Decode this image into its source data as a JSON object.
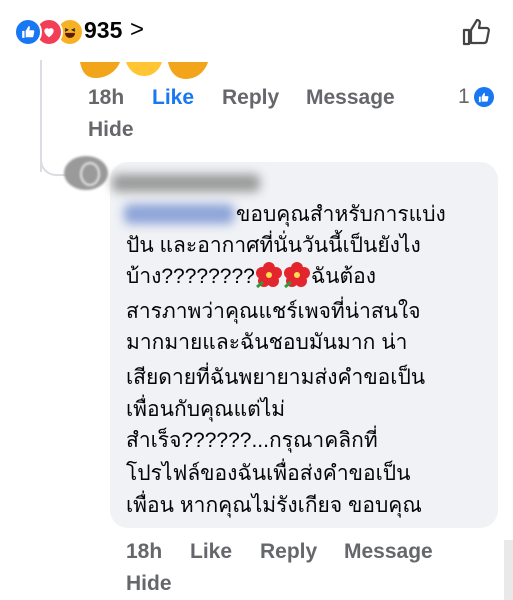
{
  "header": {
    "reaction_count": "935",
    "count_arrow": ">",
    "reaction_icons": [
      "like-icon",
      "love-icon",
      "haha-icon"
    ],
    "like_page_icon": "thumb-up-icon"
  },
  "prev_comment": {
    "time": "18h",
    "like": "Like",
    "reply": "Reply",
    "message": "Message",
    "hide": "Hide",
    "reaction_count": "1",
    "like_color": "#1877f2"
  },
  "comment": {
    "lines": [
      "ขอบคุณสำหรับการแบ่ง",
      "ปัน และอากาศที่นั่นวันนี้เป็นยังไง",
      "บ้าง????????",
      "ฉันต้อง",
      "สารภาพว่าคุณแชร์เพจที่น่าสนใจ",
      "มากมายและฉันชอบมันมาก น่า",
      "เสียดายที่ฉันพยายามส่งคำขอเป็น",
      "เพื่อนกับคุณแต่ไม่",
      "สำเร็จ??????...กรุณาคลิกที่",
      "โปรไฟล์ของฉันเพื่อส่งคำขอเป็น",
      "เพื่อน หากคุณไม่รังเกียจ ขอบคุณ"
    ],
    "flower_icons": [
      "hibiscus-icon",
      "hibiscus-icon"
    ],
    "time": "18h",
    "like": "Like",
    "reply": "Reply",
    "message": "Message",
    "hide": "Hide"
  }
}
